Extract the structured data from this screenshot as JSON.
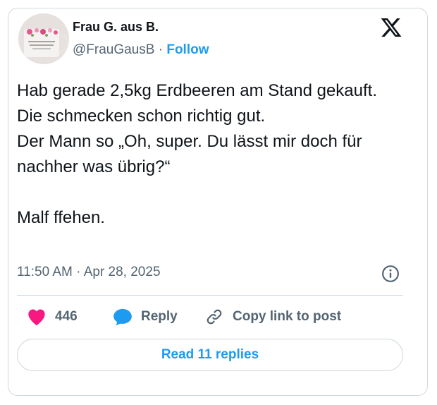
{
  "author": {
    "display_name": "Frau G. aus B.",
    "handle": "@FrauGausB",
    "separator": " · ",
    "follow_label": "Follow",
    "avatar_mug_text": "Ein Mug zum Kaffee"
  },
  "platform_icon": "x-logo-icon",
  "tweet": {
    "lines": [
      "Hab gerade 2,5kg Erdbeeren am Stand gekauft. Die schmecken schon richtig gut.",
      "Der Mann so „Oh, super. Du lässt mir doch für nachher was übrig?“",
      "Malf ffehen."
    ]
  },
  "timestamp": "11:50 AM · Apr 28, 2025",
  "actions": {
    "like_count": "446",
    "reply_label": "Reply",
    "copy_link_label": "Copy link to post"
  },
  "read_replies_label": "Read 11 replies",
  "colors": {
    "accent": "#1d9bf0",
    "like": "#f91880",
    "text": "#0f1419",
    "muted": "#536471",
    "border": "#cfd9de"
  }
}
